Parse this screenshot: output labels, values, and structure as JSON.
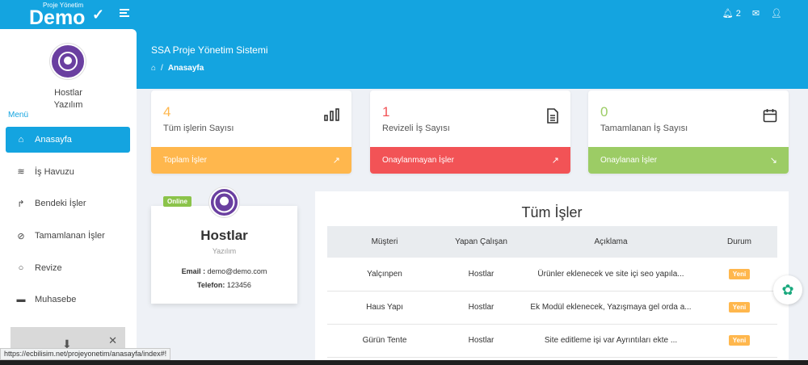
{
  "logo": {
    "sub": "Proje Yönetim",
    "main": "Demo"
  },
  "topbar": {
    "notification_count": "2"
  },
  "sidebar": {
    "user_name": "Hostlar",
    "user_company": "Yazılım",
    "menu_title": "Menü",
    "items": [
      {
        "label": "Anasayfa",
        "icon": "home-icon"
      },
      {
        "label": "İş Havuzu",
        "icon": "layers-icon"
      },
      {
        "label": "Bendeki İşler",
        "icon": "share-icon"
      },
      {
        "label": "Tamamlanan İşler",
        "icon": "check-circle-icon"
      },
      {
        "label": "Revize",
        "icon": "chat-icon"
      },
      {
        "label": "Muhasebe",
        "icon": "wallet-icon"
      }
    ]
  },
  "page": {
    "title": "SSA Proje Yönetim Sistemi",
    "breadcrumb_current": "Anasayfa"
  },
  "stats": [
    {
      "value": "4",
      "label": "Tüm işlerin Sayısı",
      "footer": "Toplam İşler",
      "color": "#ffb74d",
      "num_color": "#ffb74d",
      "icon": "bar-chart-icon"
    },
    {
      "value": "1",
      "label": "Revizeli İş Sayısı",
      "footer": "Onaylanmayan İşler",
      "color": "#f25356",
      "num_color": "#f25356",
      "icon": "document-icon"
    },
    {
      "value": "0",
      "label": "Tamamlanan İş Sayısı",
      "footer": "Onaylanan İşler",
      "color": "#9ccc65",
      "num_color": "#9ccc65",
      "icon": "calendar-icon"
    }
  ],
  "profile": {
    "status": "Online",
    "name": "Hostlar",
    "role": "Yazılım",
    "email_label": "Email :",
    "email": "demo@demo.com",
    "phone_label": "Telefon:",
    "phone": "123456"
  },
  "jobs": {
    "title": "Tüm İşler",
    "columns": [
      "Müşteri",
      "Yapan Çalışan",
      "Açıklama",
      "Durum"
    ],
    "rows": [
      {
        "customer": "Yalçınpen",
        "worker": "Hostlar",
        "desc": "Ürünler eklenecek ve site içi seo yapıla...",
        "status": "Yeni"
      },
      {
        "customer": "Haus Yapı",
        "worker": "Hostlar",
        "desc": "Ek Modül eklenecek, Yazışmaya gel orda a...",
        "status": "Yeni"
      },
      {
        "customer": "Gürün Tente",
        "worker": "Hostlar",
        "desc": "Site editleme işi var Ayrıntıları ekte ...",
        "status": "Yeni"
      }
    ]
  },
  "status_url": "https://ecbilisim.net/projeyonetim/anasayfa/index#!"
}
